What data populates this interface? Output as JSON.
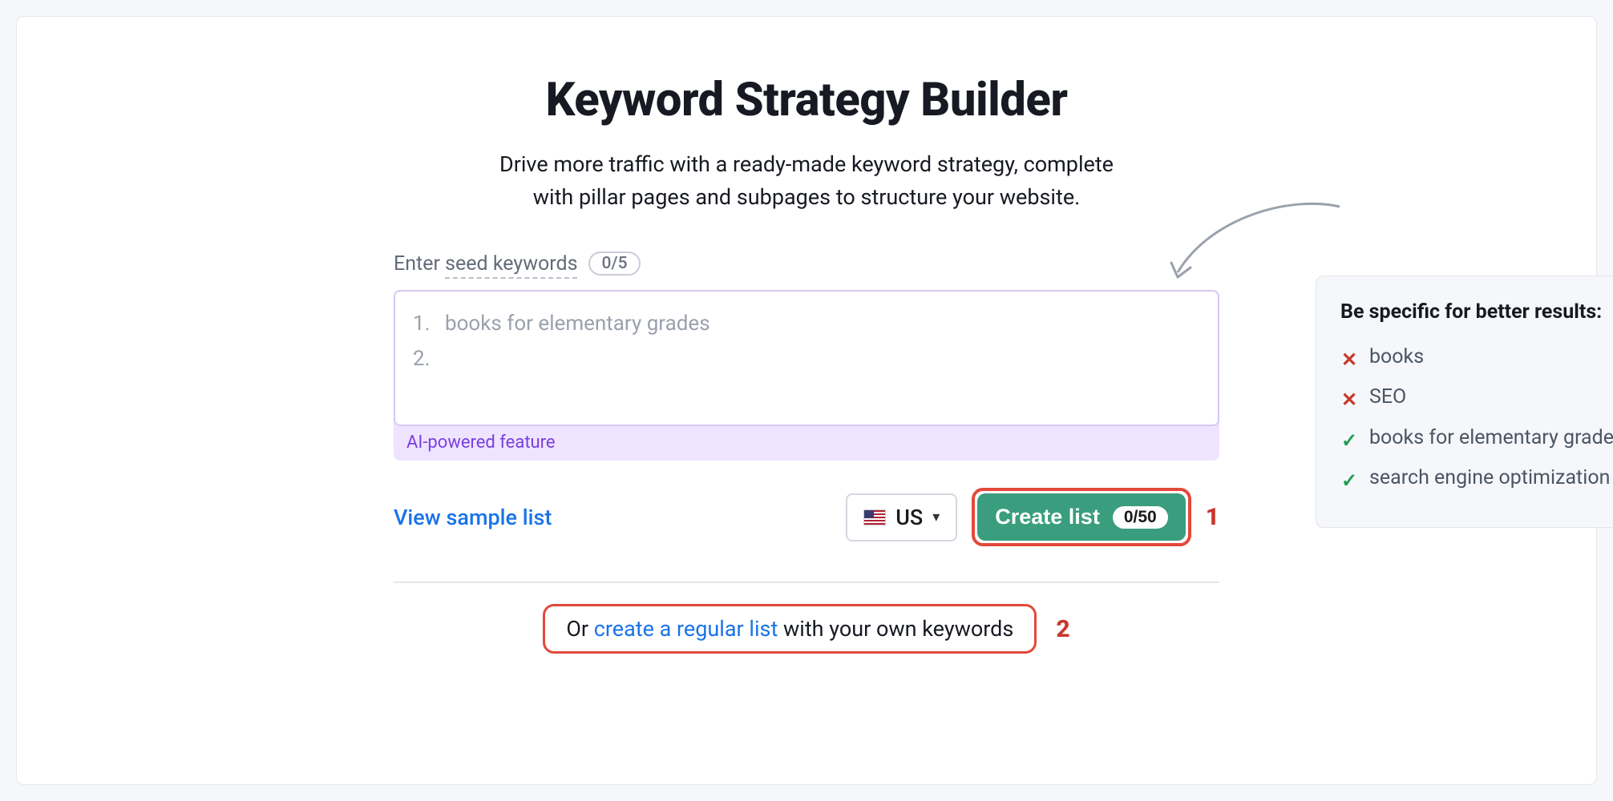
{
  "header": {
    "title": "Keyword Strategy Builder",
    "subtitle_line1": "Drive more traffic with a ready-made keyword strategy, complete",
    "subtitle_line2": "with pillar pages and subpages to structure your website."
  },
  "seed": {
    "label_prefix": "Enter ",
    "label_dotted": "seed keywords",
    "count": "0/5",
    "placeholder_1_num": "1.",
    "placeholder_1_text": "books for elementary grades",
    "placeholder_2_num": "2.",
    "ai_label": "AI-powered feature"
  },
  "actions": {
    "view_sample": "View sample list",
    "country": "US",
    "create_label": "Create list",
    "create_count": "0/50"
  },
  "callouts": {
    "one": "1",
    "two": "2"
  },
  "alt": {
    "prefix": "Or ",
    "link": "create a regular list",
    "suffix": " with your own keywords"
  },
  "tips": {
    "title": "Be specific for better results:",
    "bad": [
      "books",
      "SEO"
    ],
    "good": [
      "books for elementary grades",
      "search engine optimization"
    ]
  }
}
